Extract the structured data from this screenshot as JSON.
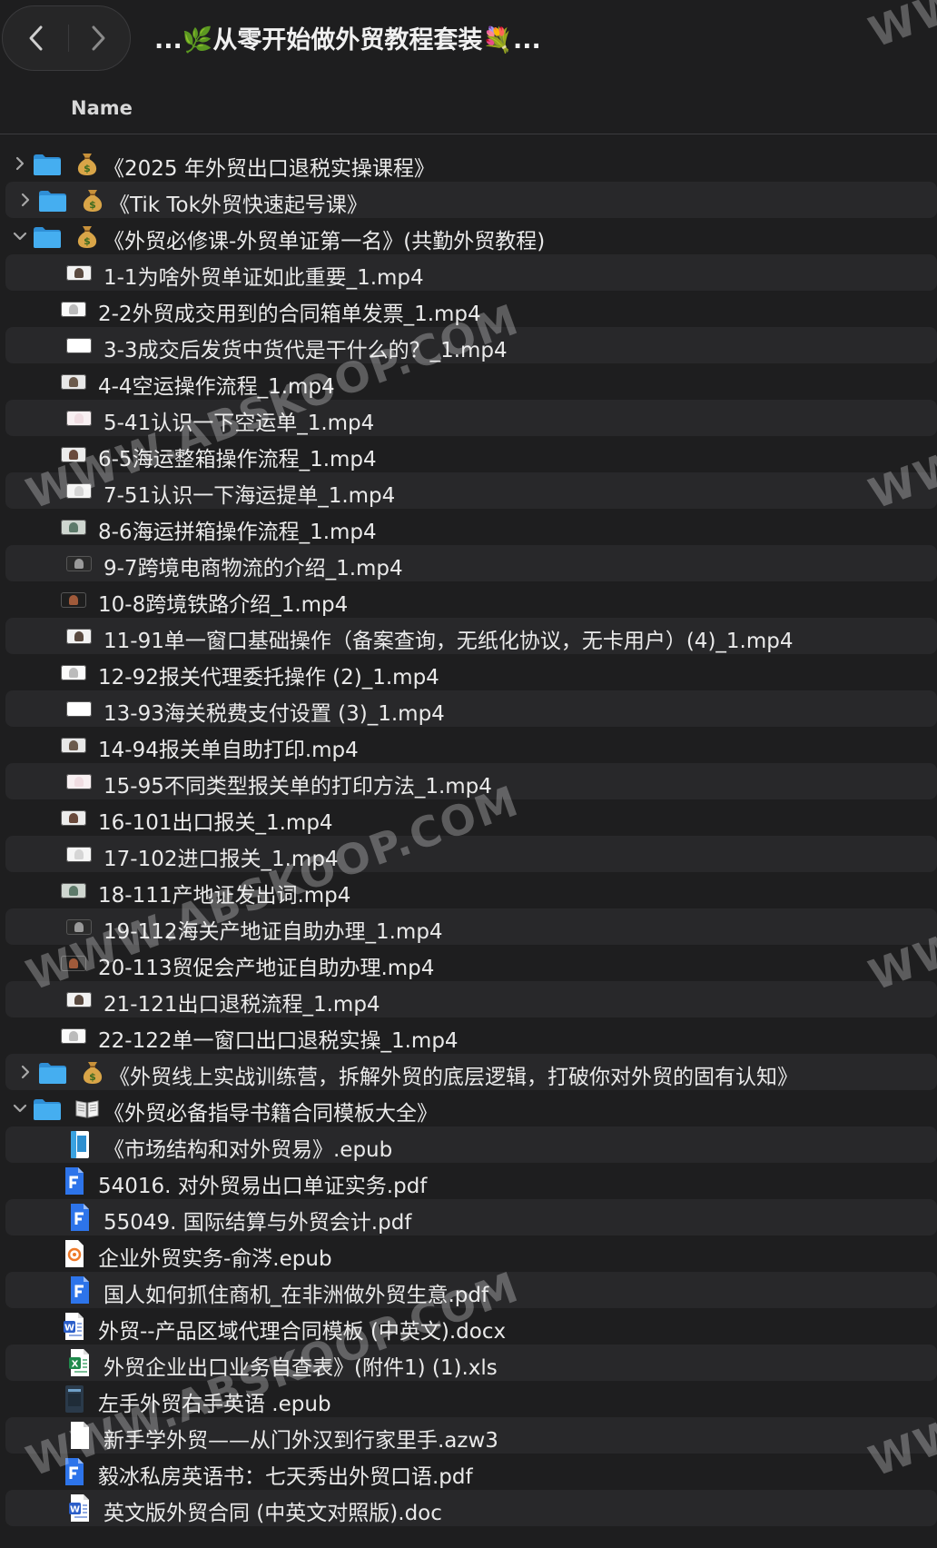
{
  "window": {
    "title": "...🌿从零开始做外贸教程套装💐..."
  },
  "header": {
    "name_column": "Name"
  },
  "colors": {
    "folder_blue": "#3b9fe0",
    "pdf_blue": "#1f6fe8",
    "background": "#1e1e1f",
    "row_alt": "#28282a"
  },
  "rows": [
    {
      "kind": "folder",
      "expanded": false,
      "emoji": "money-bag-icon",
      "label": "《2025 年外贸出口退税实操课程》"
    },
    {
      "kind": "folder",
      "expanded": false,
      "emoji": "money-bag-icon",
      "label": "《Tik Tok外贸快速起号课》"
    },
    {
      "kind": "folder",
      "expanded": true,
      "emoji": "money-bag-icon",
      "label": "《外贸必修课-外贸单证第一名》(共勤外贸教程)"
    },
    {
      "kind": "video",
      "label": "1-1为啥外贸单证如此重要_1.mp4"
    },
    {
      "kind": "video",
      "label": "2-2外贸成交用到的合同箱单发票_1.mp4"
    },
    {
      "kind": "video",
      "label": "3-3成交后发货中货代是干什么的？_1.mp4"
    },
    {
      "kind": "video",
      "label": "4-4空运操作流程_1.mp4"
    },
    {
      "kind": "video",
      "label": "5-41认识一下空运单_1.mp4"
    },
    {
      "kind": "video",
      "label": "6-5海运整箱操作流程_1.mp4"
    },
    {
      "kind": "video",
      "label": "7-51认识一下海运提单_1.mp4"
    },
    {
      "kind": "video",
      "label": "8-6海运拼箱操作流程_1.mp4"
    },
    {
      "kind": "video",
      "label": "9-7跨境电商物流的介绍_1.mp4"
    },
    {
      "kind": "video",
      "label": "10-8跨境铁路介绍_1.mp4"
    },
    {
      "kind": "video",
      "label": "11-91单一窗口基础操作（备案查询，无纸化协议，无卡用户）(4)_1.mp4"
    },
    {
      "kind": "video",
      "label": "12-92报关代理委托操作 (2)_1.mp4"
    },
    {
      "kind": "video",
      "label": "13-93海关税费支付设置 (3)_1.mp4"
    },
    {
      "kind": "video",
      "label": "14-94报关单自助打印.mp4"
    },
    {
      "kind": "video",
      "label": "15-95不同类型报关单的打印方法_1.mp4"
    },
    {
      "kind": "video",
      "label": "16-101出口报关_1.mp4"
    },
    {
      "kind": "video",
      "label": "17-102进口报关_1.mp4"
    },
    {
      "kind": "video",
      "label": "18-111产地证发出词.mp4"
    },
    {
      "kind": "video",
      "label": "19-112海关产地证自助办理_1.mp4"
    },
    {
      "kind": "video",
      "label": "20-113贸促会产地证自助办理.mp4"
    },
    {
      "kind": "video",
      "label": "21-121出口退税流程_1.mp4"
    },
    {
      "kind": "video",
      "label": "22-122单一窗口出口退税实操_1.mp4"
    },
    {
      "kind": "folder",
      "expanded": false,
      "emoji": "money-bag-icon",
      "label": "《外贸线上实战训练营，拆解外贸的底层逻辑，打破你对外贸的固有认知》"
    },
    {
      "kind": "folder",
      "expanded": true,
      "emoji": "open-book-icon",
      "label": "《外贸必备指导书籍合同模板大全》"
    },
    {
      "kind": "epub",
      "label": "《市场结构和对外贸易》.epub"
    },
    {
      "kind": "pdf",
      "label": "54016. 对外贸易出口单证实务.pdf"
    },
    {
      "kind": "pdf",
      "label": "55049. 国际结算与外贸会计.pdf"
    },
    {
      "kind": "epub-orange",
      "label": "企业外贸实务-俞涔.epub"
    },
    {
      "kind": "pdf",
      "label": "国人如何抓住商机_在非洲做外贸生意.pdf"
    },
    {
      "kind": "word",
      "label": "外贸--产品区域代理合同模板 (中英文).docx"
    },
    {
      "kind": "excel",
      "label": "外贸企业出口业务自查表》(附件1) (1).xls"
    },
    {
      "kind": "epub-dark",
      "label": "左手外贸右手英语 .epub"
    },
    {
      "kind": "azw",
      "label": "新手学外贸——从门外汉到行家里手.azw3"
    },
    {
      "kind": "pdf",
      "label": "毅冰私房英语书：七天秀出外贸口语.pdf"
    },
    {
      "kind": "word",
      "label": "英文版外贸合同 (中英文对照版).doc"
    }
  ],
  "watermarks": [
    "WWW.ABSKOOP.COM",
    "WWW.ABSKOOP.COM",
    "WWW.ABSKOOP.COM",
    "WWW.",
    "WWW.",
    "WWW.",
    "WWW."
  ]
}
